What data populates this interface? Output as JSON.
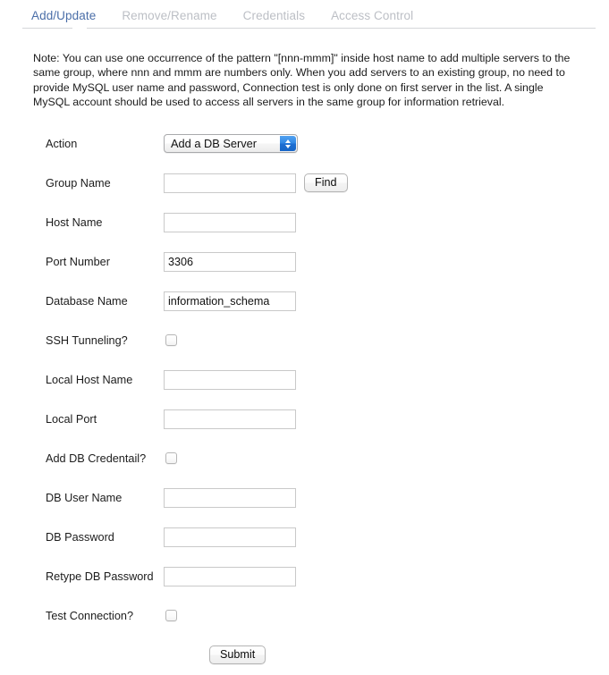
{
  "tabs": [
    {
      "label": "Add/Update",
      "active": true
    },
    {
      "label": "Remove/Rename",
      "active": false
    },
    {
      "label": "Credentials",
      "active": false
    },
    {
      "label": "Access Control",
      "active": false
    }
  ],
  "note": "Note: You can use one occurrence of the pattern \"[nnn-mmm]\" inside host name to add multiple servers to the same group, where nnn and mmm are numbers only. When you add servers to an existing group, no need to provide MySQL user name and password, Connection test is only done on first server in the list. A single MySQL account should be used to access all servers in the same group for information retrieval.",
  "form": {
    "action": {
      "label": "Action",
      "selected": "Add a DB Server",
      "options": [
        "Add a DB Server"
      ]
    },
    "group_name": {
      "label": "Group Name",
      "value": "",
      "find_label": "Find"
    },
    "host_name": {
      "label": "Host Name",
      "value": ""
    },
    "port_number": {
      "label": "Port Number",
      "value": "3306"
    },
    "database_name": {
      "label": "Database Name",
      "value": "information_schema"
    },
    "ssh_tunneling": {
      "label": "SSH Tunneling?",
      "checked": false
    },
    "local_host_name": {
      "label": "Local Host Name",
      "value": ""
    },
    "local_port": {
      "label": "Local Port",
      "value": ""
    },
    "add_db_credential": {
      "label": "Add DB Credentail?",
      "checked": false
    },
    "db_user_name": {
      "label": "DB User Name",
      "value": ""
    },
    "db_password": {
      "label": "DB Password",
      "value": ""
    },
    "retype_db_password": {
      "label": "Retype DB Password",
      "value": ""
    },
    "test_connection": {
      "label": "Test Connection?",
      "checked": false
    },
    "submit_label": "Submit"
  },
  "colors": {
    "active_tab": "#4a6ea8",
    "inactive_tab": "#bcbfc5",
    "select_button": "#2f86e4",
    "input_border": "#c9c9c9",
    "divider": "#d5d7da"
  }
}
